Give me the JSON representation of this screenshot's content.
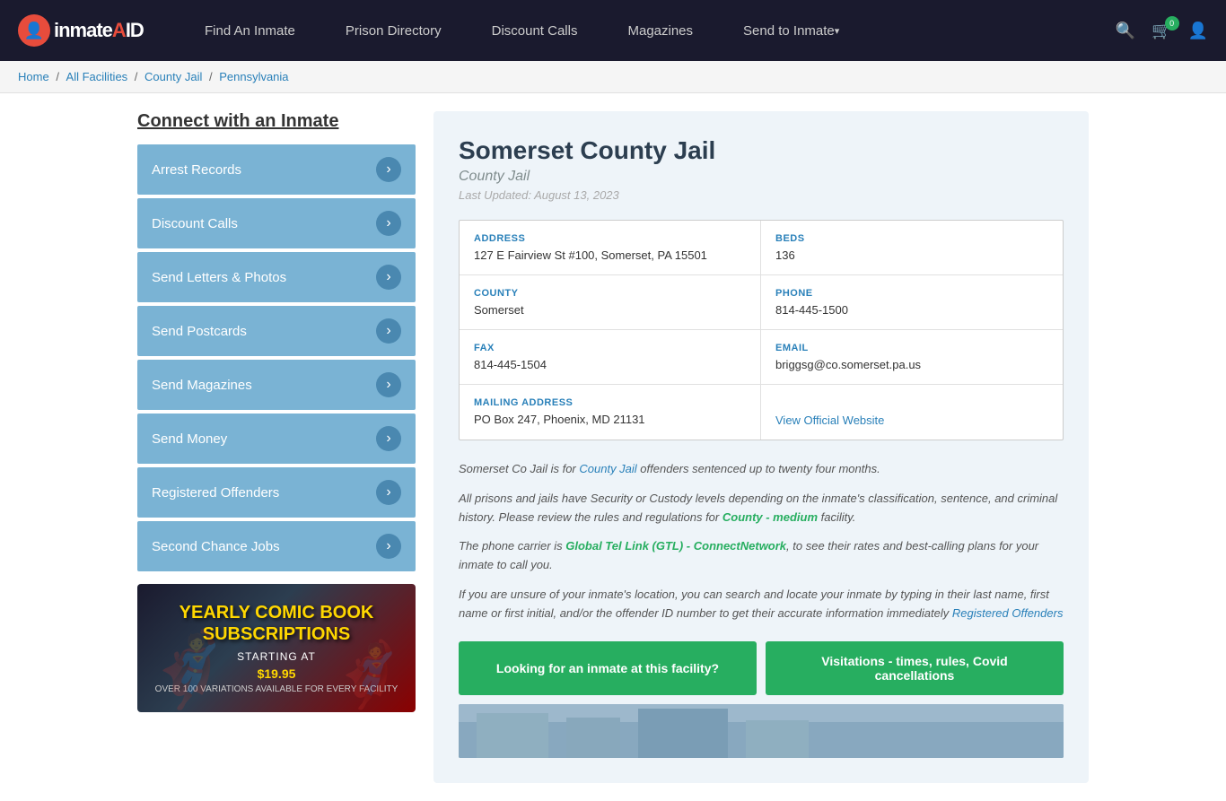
{
  "header": {
    "logo": "inmateAID",
    "nav": [
      {
        "label": "Find An Inmate",
        "id": "find-inmate"
      },
      {
        "label": "Prison Directory",
        "id": "prison-directory"
      },
      {
        "label": "Discount Calls",
        "id": "discount-calls"
      },
      {
        "label": "Magazines",
        "id": "magazines"
      },
      {
        "label": "Send to Inmate",
        "id": "send-to-inmate",
        "dropdown": true
      }
    ],
    "cart_count": "0"
  },
  "breadcrumb": {
    "items": [
      "Home",
      "All Facilities",
      "County Jail",
      "Pennsylvania"
    ]
  },
  "sidebar": {
    "title": "Connect with an Inmate",
    "menu": [
      {
        "label": "Arrest Records"
      },
      {
        "label": "Discount Calls"
      },
      {
        "label": "Send Letters & Photos"
      },
      {
        "label": "Send Postcards"
      },
      {
        "label": "Send Magazines"
      },
      {
        "label": "Send Money"
      },
      {
        "label": "Registered Offenders"
      },
      {
        "label": "Second Chance Jobs"
      }
    ],
    "ad": {
      "title": "YEARLY COMIC BOOK\nSUBSCRIPTIONS",
      "subtitle": "Starting at",
      "price": "$19.95",
      "desc": "OVER 100 VARIATIONS AVAILABLE FOR EVERY FACILITY"
    }
  },
  "facility": {
    "name": "Somerset County Jail",
    "type": "County Jail",
    "last_updated": "Last Updated: August 13, 2023",
    "address_label": "ADDRESS",
    "address_value": "127 E Fairview St #100, Somerset, PA 15501",
    "beds_label": "BEDS",
    "beds_value": "136",
    "county_label": "COUNTY",
    "county_value": "Somerset",
    "phone_label": "PHONE",
    "phone_value": "814-445-1500",
    "fax_label": "FAX",
    "fax_value": "814-445-1504",
    "email_label": "EMAIL",
    "email_value": "briggsg@co.somerset.pa.us",
    "mailing_label": "MAILING ADDRESS",
    "mailing_value": "PO Box 247, Phoenix, MD 21131",
    "website_label": "View Official Website",
    "desc1": "Somerset Co Jail is for County Jail offenders sentenced up to twenty four months.",
    "desc2": "All prisons and jails have Security or Custody levels depending on the inmate's classification, sentence, and criminal history. Please review the rules and regulations for County - medium facility.",
    "desc3": "The phone carrier is Global Tel Link (GTL) - ConnectNetwork, to see their rates and best-calling plans for your inmate to call you.",
    "desc4": "If you are unsure of your inmate's location, you can search and locate your inmate by typing in their last name, first name or first initial, and/or the offender ID number to get their accurate information immediately Registered Offenders",
    "btn1": "Looking for an inmate at this facility?",
    "btn2": "Visitations - times, rules, Covid cancellations"
  }
}
